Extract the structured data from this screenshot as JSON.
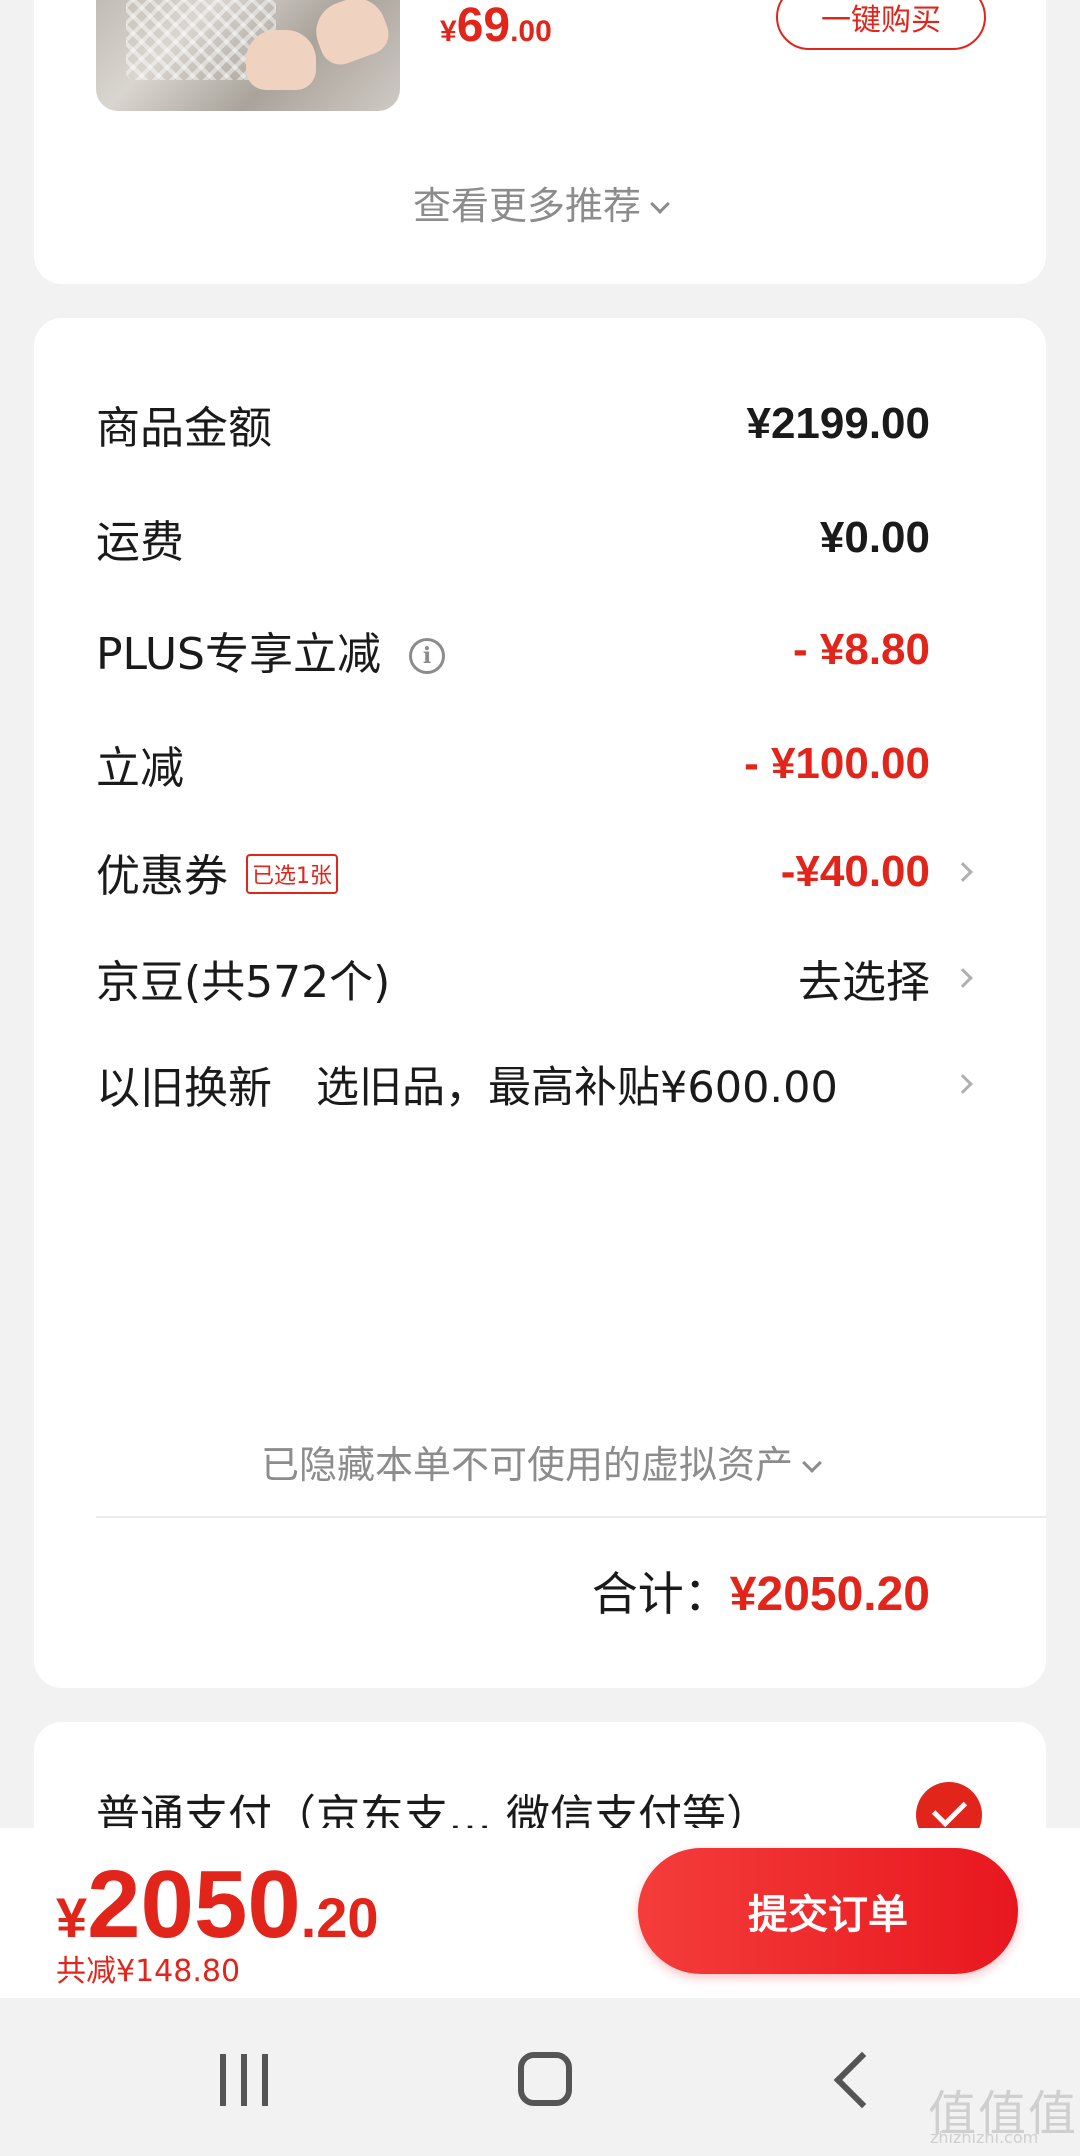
{
  "recommend": {
    "price_currency": "¥",
    "price_integer": "69",
    "price_decimal": ".00",
    "buy_now_label": "一键购买",
    "more_label": "查看更多推荐"
  },
  "summary": {
    "rows": [
      {
        "label": "商品金额",
        "value": "¥2199.00"
      },
      {
        "label": "运费",
        "value": "¥0.00"
      },
      {
        "label": "PLUS专享立减",
        "value": "- ¥8.80"
      },
      {
        "label": "立减",
        "value": "- ¥100.00"
      },
      {
        "label": "优惠券",
        "tag": "已选1张",
        "value": "-¥40.00"
      },
      {
        "label": "京豆(共572个)",
        "value": "去选择"
      },
      {
        "label": "以旧换新",
        "value": "选旧品，最高补贴¥600.00"
      }
    ],
    "info_icon_glyph": "i",
    "hidden_assets_label": "已隐藏本单不可使用的虚拟资产",
    "total_label": "合计：",
    "total_value": "¥2050.20"
  },
  "payment": {
    "label": "普通支付（京东支… 微信支付等）",
    "selected": true
  },
  "bottom_bar": {
    "price_currency": "¥",
    "price_integer": "2050",
    "price_decimal": ".20",
    "saved_label": "共减¥148.80",
    "submit_label": "提交订单"
  },
  "watermark": {
    "main": "值值值",
    "sub": "zhizhizhi.com"
  },
  "colors": {
    "accent": "#e1251b",
    "background": "#f2f2f2",
    "card": "#ffffff",
    "muted_text": "#8c8c8c"
  },
  "icons": {
    "info": "info-circle-icon",
    "chevron_right": "chevron-right-icon",
    "chevron_down": "chevron-down-icon",
    "check": "check-circle-icon",
    "nav_recents": "recents-icon",
    "nav_home": "home-icon",
    "nav_back": "back-icon"
  }
}
